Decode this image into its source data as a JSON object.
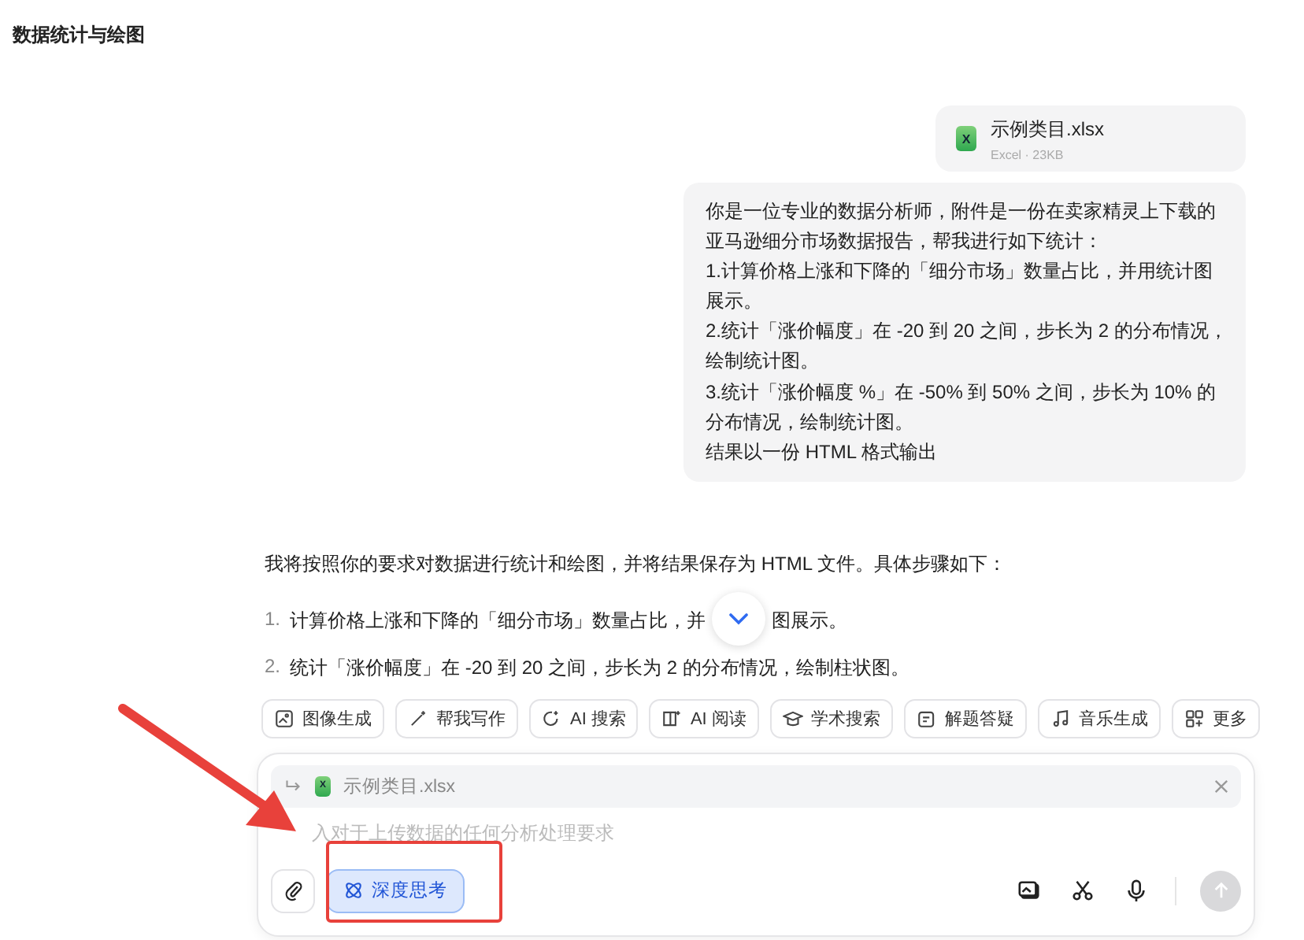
{
  "header": {
    "title": "数据统计与绘图"
  },
  "user_file": {
    "badge": "X",
    "name": "示例类目.xlsx",
    "meta": "Excel · 23KB"
  },
  "user_message": {
    "lines": [
      "你是一位专业的数据分析师，附件是一份在卖家精灵上下载的亚马逊细分市场数据报告，帮我进行如下统计：",
      "1.计算价格上涨和下降的「细分市场」数量占比，并用统计图展示。",
      "2.统计「涨价幅度」在 -20 到 20 之间，步长为 2 的分布情况，绘制统计图。",
      "3.统计「涨价幅度 %」在 -50% 到 50% 之间，步长为 10% 的分布情况，绘制统计图。",
      "结果以一份 HTML 格式输出"
    ]
  },
  "reply": {
    "intro": "我将按照你的要求对数据进行统计和绘图，并将结果保存为 HTML 文件。具体步骤如下：",
    "steps": [
      {
        "number": "1.",
        "parts": [
          "计算价格上涨和下降的「细分市场」数量占比，并",
          "图展示。"
        ]
      },
      {
        "number": "2.",
        "parts": [
          "统计「涨价幅度」在 -20 到 20 之间，步长为 2 的分布情况，绘制柱状图。"
        ]
      }
    ]
  },
  "tools": [
    {
      "label": "图像生成"
    },
    {
      "label": "帮我写作"
    },
    {
      "label": "AI 搜索"
    },
    {
      "label": "AI 阅读"
    },
    {
      "label": "学术搜索"
    },
    {
      "label": "解题答疑"
    },
    {
      "label": "音乐生成"
    },
    {
      "label": "更多"
    }
  ],
  "composer": {
    "attachment": {
      "badge": "X",
      "name": "示例类目.xlsx"
    },
    "placeholder": "入对于上传数据的任何分析处理要求",
    "deep_think": {
      "label": "深度思考",
      "selected": true
    }
  }
}
